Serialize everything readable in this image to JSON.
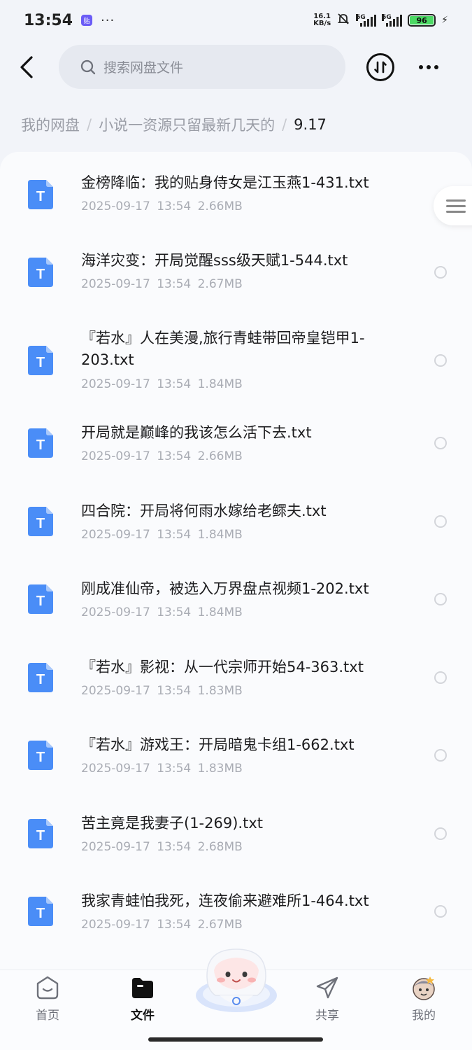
{
  "status_bar": {
    "time": "13:54",
    "app_badge": "贴",
    "dots": "···",
    "net_speed_value": "16.1",
    "net_speed_unit": "KB/s",
    "signal1_label": "5G",
    "signal2_label": "5G",
    "battery": "96"
  },
  "header": {
    "search_placeholder": "搜索网盘文件"
  },
  "breadcrumb": {
    "root": "我的网盘",
    "folder": "小说一资源只留最新几天的",
    "current": "9.17",
    "separator": "/"
  },
  "files": [
    {
      "name": "金榜降临：我的贴身侍女是江玉燕1-431.txt",
      "date": "2025-09-17",
      "time": "13:54",
      "size": "2.66MB"
    },
    {
      "name": "海洋灾变：开局觉醒sss级天赋1-544.txt",
      "date": "2025-09-17",
      "time": "13:54",
      "size": "2.67MB"
    },
    {
      "name": "『若水』人在美漫,旅行青蛙带回帝皇铠甲1-203.txt",
      "date": "2025-09-17",
      "time": "13:54",
      "size": "1.84MB"
    },
    {
      "name": "开局就是巅峰的我该怎么活下去.txt",
      "date": "2025-09-17",
      "time": "13:54",
      "size": "2.66MB"
    },
    {
      "name": "四合院：开局将何雨水嫁给老鳏夫.txt",
      "date": "2025-09-17",
      "time": "13:54",
      "size": "1.84MB"
    },
    {
      "name": "刚成准仙帝，被选入万界盘点视频1-202.txt",
      "date": "2025-09-17",
      "time": "13:54",
      "size": "1.84MB"
    },
    {
      "name": "『若水』影视：从一代宗师开始54-363.txt",
      "date": "2025-09-17",
      "time": "13:54",
      "size": "1.83MB"
    },
    {
      "name": "『若水』游戏王：开局暗鬼卡组1-662.txt",
      "date": "2025-09-17",
      "time": "13:54",
      "size": "1.83MB"
    },
    {
      "name": "苦主竟是我妻子(1-269).txt",
      "date": "2025-09-17",
      "time": "13:54",
      "size": "2.68MB"
    },
    {
      "name": "我家青蛙怕我死，连夜偷来避难所1-464.txt",
      "date": "2025-09-17",
      "time": "13:54",
      "size": "2.67MB"
    }
  ],
  "file_icon_letter": "T",
  "bottom_nav": {
    "home": "首页",
    "files": "文件",
    "share": "共享",
    "mine": "我的"
  },
  "colors": {
    "accent": "#3b82f6",
    "file_icon": "#4a8df7",
    "battery": "#4cd964"
  }
}
